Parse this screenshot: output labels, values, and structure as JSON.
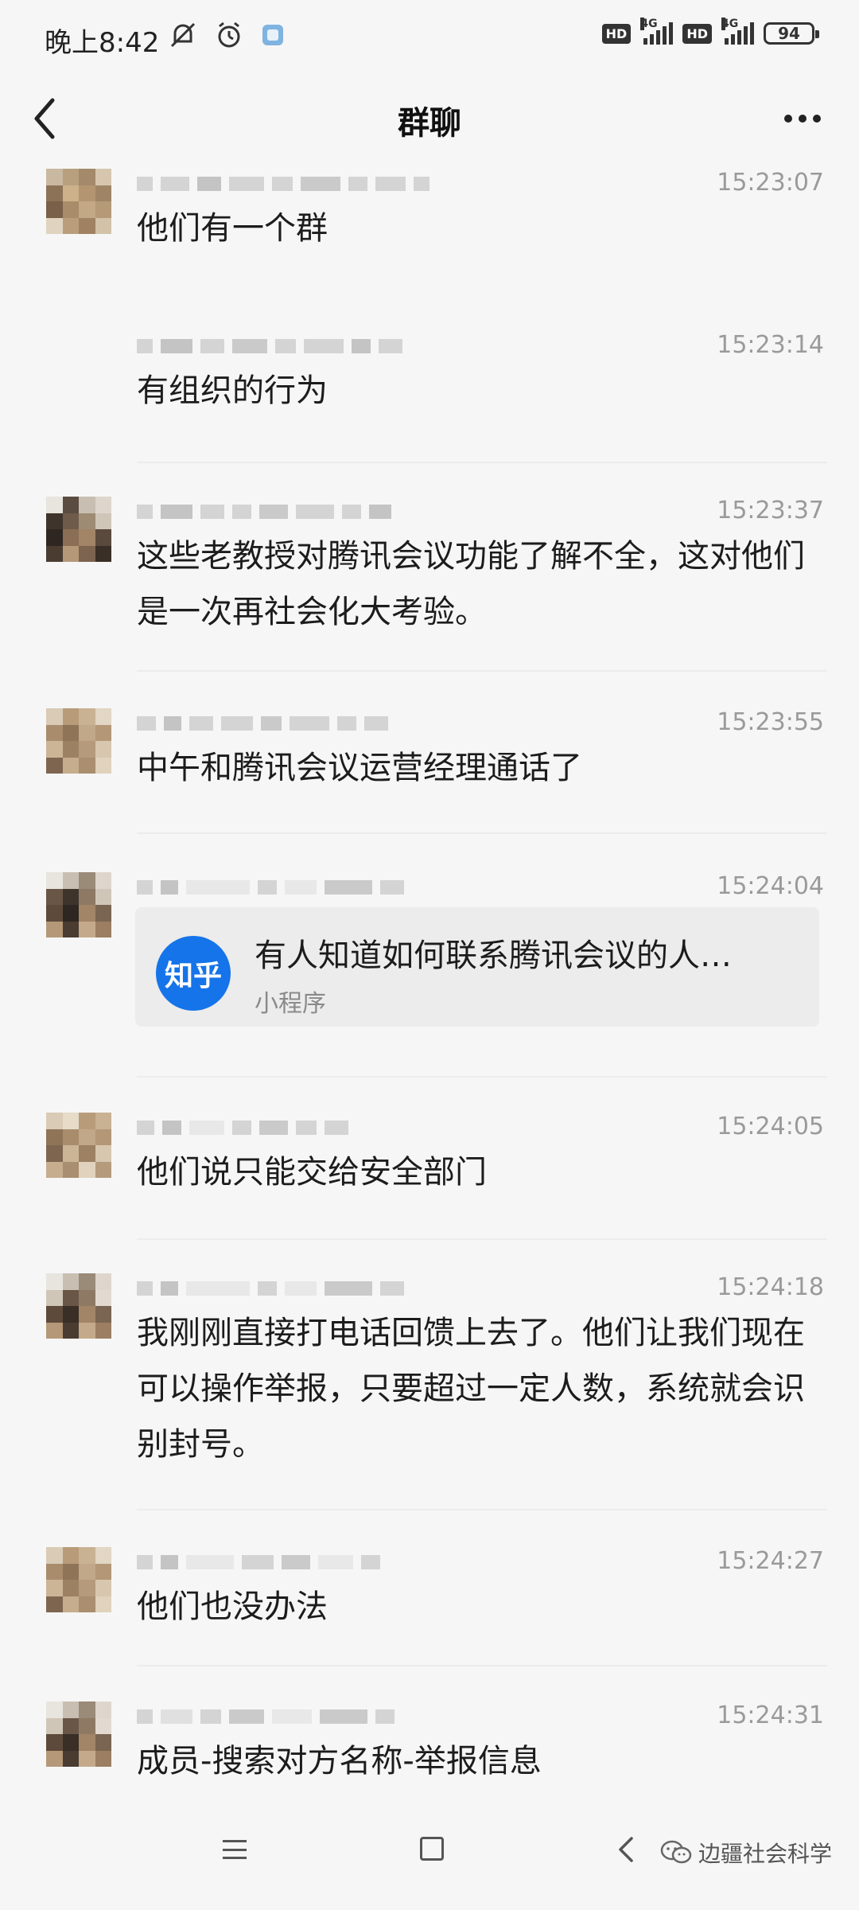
{
  "status_bar": {
    "time": "晚上8:42",
    "battery": "94",
    "hd_label": "HD",
    "network": "4G"
  },
  "header": {
    "title": "群聊"
  },
  "messages": [
    {
      "time": "15:23:07",
      "text": "他们有一个群",
      "avatar": true
    },
    {
      "time": "15:23:14",
      "text": "有组织的行为",
      "avatar": false
    },
    {
      "time": "15:23:37",
      "text": "这些老教授对腾讯会议功能了解不全，这对他们是一次再社会化大考验。",
      "avatar": true
    },
    {
      "time": "15:23:55",
      "text": "中午和腾讯会议运营经理通话了",
      "avatar": true
    },
    {
      "time": "15:24:04",
      "card": {
        "icon_label": "知乎",
        "title": "有人知道如何联系腾讯会议的人…",
        "subtitle": "小程序"
      },
      "avatar": true
    },
    {
      "time": "15:24:05",
      "text": "他们说只能交给安全部门",
      "avatar": true
    },
    {
      "time": "15:24:18",
      "text": "我刚刚直接打电话回馈上去了。他们让我们现在可以操作举报，只要超过一定人数，系统就会识别封号。",
      "avatar": true
    },
    {
      "time": "15:24:27",
      "text": "他们也没办法",
      "avatar": true
    },
    {
      "time": "15:24:31",
      "text": "成员-搜索对方名称-举报信息",
      "avatar": true
    }
  ],
  "watermark": "边疆社会科学",
  "icons": {
    "back": "chevron-left-icon",
    "more": "more-dots-icon",
    "mini_program": "zhihu-logo-icon"
  }
}
